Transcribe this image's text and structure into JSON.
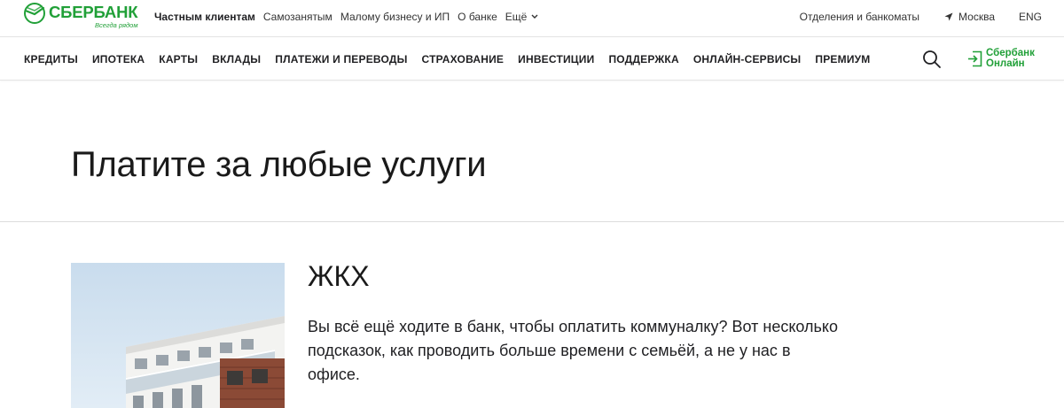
{
  "brand": {
    "name": "СБЕРБАНК",
    "slogan": "Всегда рядом",
    "color": "#21a038"
  },
  "top_nav": {
    "segments": [
      "Частным клиентам",
      "Самозанятым",
      "Малому бизнесу и ИП",
      "О банке"
    ],
    "active_segment": "Частным клиентам",
    "more_label": "Ещё",
    "branches_label": "Отделения и банкоматы",
    "city_label": "Москва",
    "lang_label": "ENG"
  },
  "main_nav": {
    "items": [
      "КРЕДИТЫ",
      "ИПОТЕКА",
      "КАРТЫ",
      "ВКЛАДЫ",
      "ПЛАТЕЖИ И ПЕРЕВОДЫ",
      "СТРАХОВАНИЕ",
      "ИНВЕСТИЦИИ",
      "ПОДДЕРЖКА",
      "ОНЛАЙН-СЕРВИСЫ",
      "ПРЕМИУМ"
    ],
    "search_icon": "search-icon",
    "online_line1": "Сбербанк",
    "online_line2": "Онлайн"
  },
  "hero": {
    "title": "Платите за любые услуги"
  },
  "card": {
    "title": "ЖКХ",
    "text": "Вы всё ещё ходите в банк, чтобы оплатить коммуналку? Вот несколько подсказок, как проводить больше времени с семьёй, а не у нас в офисе.",
    "image": "apartment-building-photo"
  }
}
